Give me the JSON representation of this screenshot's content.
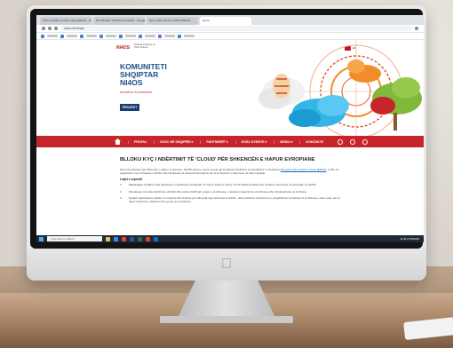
{
  "browser": {
    "tabs": [
      {
        "label": "NCKU Yardım merkezi nasıl kullanılır - Google"
      },
      {
        "label": "Nd: Website 'Ushtrimi Komunitet' - Google"
      },
      {
        "label": "Open Web Science NI4OS Albania"
      },
      {
        "label": "Home"
      }
    ],
    "url": "ni4os.eu/al/sq/"
  },
  "site": {
    "logo": "NI4OS",
    "logo_sub": "National Initiatives for Open Science",
    "lang": "EN",
    "hero_title_1": "KOMUNITETI",
    "hero_title_2": "SHQIPTAR",
    "hero_title_3": "NI4OS",
    "hero_subtitle": "Iniciativa Kombëtare",
    "hero_button": "PROJEKT",
    "nav": [
      "PROFILI",
      "EOSC NË SHQIPËRI ▾",
      "PARTNERËT ▾",
      "EOSC EVENTE ▾",
      "MEDIA ▾",
      "KONTAKTE"
    ],
    "article_title": "BLLOKU KYÇ I NDËRTIMIT TË 'CLOUD' PËR SHKENCËN E HAPUR EVROPIANE",
    "para1_start": "Nisma Kombëtare për Shkencën e Hapur në Evropë - NI4OS Europe, synon të jetë një kontribues thelbësor në përcaktimin e ofertës/në ",
    "para1_link": "Evropian Open Science Cloud (EOSC)",
    "para1_end": ", si dhe në angazhimin mes iniciativës e EOSC dhe iniciativave të shkencës Evropiane për të formulimin e shkencave të hapur globale.",
    "goals_heading": "Lidjet e veprimit",
    "goals": [
      "Mbështetjen zhvillimin dhe përfshirjen e iniciativave kombëtare të \"Open Science Cloud\" në 15 Shtetet Anëtare dhe Vendet e Asociuara në përputhje me EOSC.",
      "Mundësojë më lehtë shërbimet e EOSC dhe parimet FAIR për grupet e të dhënave, metoda të integrimit të shërbimeve dhe infrastrukturës në të dhëna.",
      "Ngritjen kapaciteteve lokale me trajnime dhe studime për shkencat nga përdorues të EOSC, duke përfshirë institucionet e përgjithshme të fushave të të dhënave, duke nxitur për të hapur kërkimore, shërbime dhe grupe në të dhënave."
    ]
  },
  "taskbar": {
    "search_placeholder": "Type here to search",
    "time": "14:36",
    "date": "27/04/2020"
  },
  "colors": {
    "brand_red": "#c8242b",
    "brand_blue": "#1e4f8b",
    "button_navy": "#1b3d6e"
  }
}
